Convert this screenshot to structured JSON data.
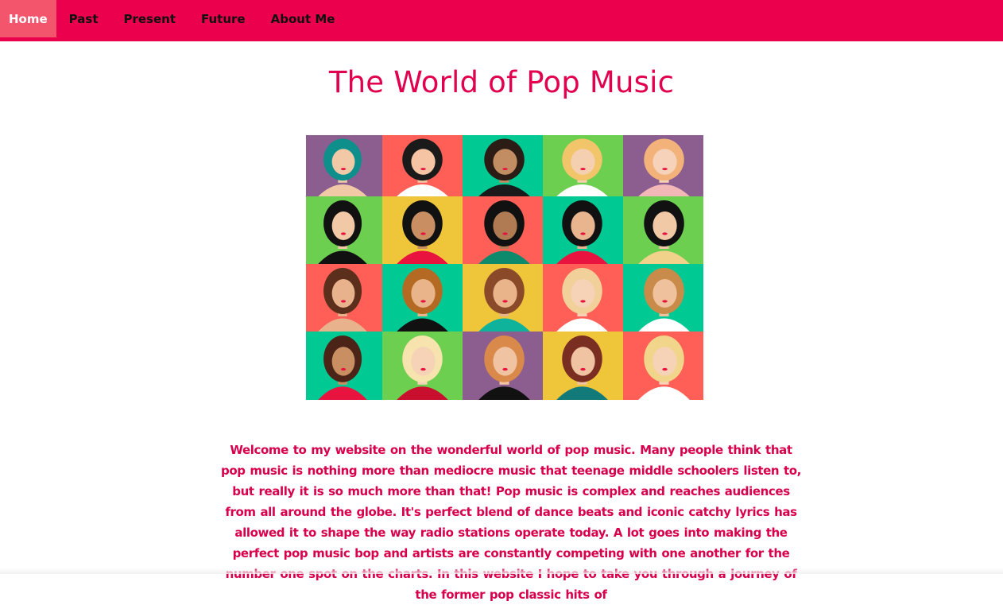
{
  "nav": {
    "items": [
      {
        "label": "Home",
        "active": true
      },
      {
        "label": "Past",
        "active": false
      },
      {
        "label": "Present",
        "active": false
      },
      {
        "label": "Future",
        "active": false
      },
      {
        "label": "About Me",
        "active": false
      }
    ]
  },
  "main": {
    "title": "The World of Pop Music",
    "intro": "Welcome to my website on the wonderful world of pop music. Many people think that pop music is nothing more than mediocre music that teenage middle schoolers listen to, but really it is so much more than that! Pop music is complex and reaches audiences from all around the globe. It's perfect blend of dance beats and iconic catchy lyrics has allowed it to shape the way radio stations operate today. A lot goes into making the perfect pop music bop and artists are constantly competing with one another for the number one spot on the charts. In this website I hope to take you through a journey of the former pop classic hits of"
  },
  "collage": {
    "tiles": [
      {
        "bg": "#8b5e8f",
        "hair": "#0e8f8c",
        "skin": "#f2c9a6",
        "top": "#f2c9a6"
      },
      {
        "bg": "#ff5f57",
        "hair": "#1a1a1a",
        "skin": "#f4c4a4",
        "top": "#ffffff"
      },
      {
        "bg": "#00c993",
        "hair": "#2b1d16",
        "skin": "#c28d63",
        "top": "#1a1a1a"
      },
      {
        "bg": "#6ccf4f",
        "hair": "#f2c56b",
        "skin": "#f4d0b0",
        "top": "#ffffff"
      },
      {
        "bg": "#8b5e8f",
        "hair": "#f2b27a",
        "skin": "#f7d2ba",
        "top": "#f2b8b8"
      },
      {
        "bg": "#6ccf4f",
        "hair": "#111111",
        "skin": "#f2c9a6",
        "top": "#111111"
      },
      {
        "bg": "#efc53a",
        "hair": "#111111",
        "skin": "#c98f62",
        "top": "#e8143f"
      },
      {
        "bg": "#ff5f57",
        "hair": "#111111",
        "skin": "#b07a53",
        "top": "#0d8a6b"
      },
      {
        "bg": "#00c993",
        "hair": "#111111",
        "skin": "#e9b58e",
        "top": "#e8143f"
      },
      {
        "bg": "#6ccf4f",
        "hair": "#111111",
        "skin": "#f2c9a6",
        "top": "#f0d28a"
      },
      {
        "bg": "#ff5f57",
        "hair": "#5b2f1b",
        "skin": "#e8b28c",
        "top": "#e8b28c"
      },
      {
        "bg": "#00c993",
        "hair": "#b56a24",
        "skin": "#e9b48a",
        "top": "#111111"
      },
      {
        "bg": "#efc53a",
        "hair": "#8a4a2a",
        "skin": "#e9b48a",
        "top": "#0fb29a"
      },
      {
        "bg": "#ff5f57",
        "hair": "#f1d09a",
        "skin": "#f6d2b7",
        "top": "#ffffff"
      },
      {
        "bg": "#00c993",
        "hair": "#c88b4a",
        "skin": "#efc19d",
        "top": "#ffffff"
      },
      {
        "bg": "#00c993",
        "hair": "#4b2417",
        "skin": "#c98f62",
        "top": "#e8143f"
      },
      {
        "bg": "#6ccf4f",
        "hair": "#f6e3ad",
        "skin": "#f6d2b7",
        "top": "#c8102e"
      },
      {
        "bg": "#8b5e8f",
        "hair": "#d98a4a",
        "skin": "#f0c3a2",
        "top": "#111111"
      },
      {
        "bg": "#efc53a",
        "hair": "#7a2e22",
        "skin": "#f0c3a2",
        "top": "#137a7a"
      },
      {
        "bg": "#ff5f57",
        "hair": "#f1d58a",
        "skin": "#f6d2b7",
        "top": "#ffffff"
      }
    ]
  },
  "colors": {
    "nav_bg": "#ea004d",
    "nav_active_bg": "#f2556c",
    "title": "#e0004d",
    "text": "#d8004b"
  }
}
